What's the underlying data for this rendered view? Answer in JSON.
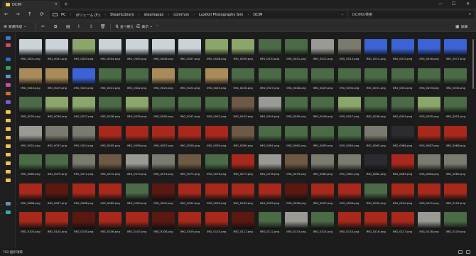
{
  "window": {
    "tab_title": "DCIM",
    "tab_close": "×",
    "tab_add": "+",
    "controls": [
      "—",
      "☐",
      "✕"
    ]
  },
  "nav": {
    "back": "←",
    "forward": "→",
    "up": "↑",
    "refresh": "⟳"
  },
  "breadcrumb": [
    "PC",
    "ボリューム (F:)",
    "SteamLibrary",
    "steamapps",
    "common",
    "Luxifoil Photography Sim",
    "DCIM"
  ],
  "breadcrumb_sep": "›",
  "search": {
    "placeholder": "DCIMの検索"
  },
  "toolbar": {
    "new_label": "新規作成",
    "sort_label": "並べ替え",
    "view_label": "表示",
    "more_label": "···",
    "details_label": "詳細"
  },
  "status": {
    "count_text": "702 個の項目"
  },
  "colors": {
    "accent": "#f2c14e",
    "thumb_palette": {
      "snow": "#c9d3d8",
      "mountain": "#8ba66a",
      "sky": "#3b63d6",
      "beach": "#a98b5a",
      "forest": "#4a6b46",
      "temple": "#7a7a6e",
      "torii": "#a8291c",
      "torii_dark": "#5a1810",
      "shrine": "#6e5a44",
      "night": "#2b2b30",
      "stone": "#9a9a94"
    }
  },
  "files": [
    {
      "name": "IMG_0001.png",
      "tone": "snow"
    },
    {
      "name": "IMG_0002.png",
      "tone": "snow"
    },
    {
      "name": "IMG_0003.png",
      "tone": "mountain"
    },
    {
      "name": "IMG_0004.png",
      "tone": "snow"
    },
    {
      "name": "IMG_0005.png",
      "tone": "snow"
    },
    {
      "name": "IMG_0006.png",
      "tone": "snow"
    },
    {
      "name": "IMG_0007.png",
      "tone": "snow"
    },
    {
      "name": "IMG_0008.png",
      "tone": "mountain"
    },
    {
      "name": "IMG_0009.png",
      "tone": "mountain"
    },
    {
      "name": "IMG_0010.png",
      "tone": "forest"
    },
    {
      "name": "IMG_0011.png",
      "tone": "forest"
    },
    {
      "name": "IMG_0012.png",
      "tone": "stone"
    },
    {
      "name": "IMG_0013.png",
      "tone": "temple"
    },
    {
      "name": "IMG_0014.png",
      "tone": "sky"
    },
    {
      "name": "IMG_0015.png",
      "tone": "sky"
    },
    {
      "name": "IMG_0016.png",
      "tone": "sky"
    },
    {
      "name": "IMG_0017.png",
      "tone": "sky"
    },
    {
      "name": "IMG_0018.png",
      "tone": "beach"
    },
    {
      "name": "IMG_0019.png",
      "tone": "beach"
    },
    {
      "name": "IMG_0020.png",
      "tone": "sky"
    },
    {
      "name": "IMG_0021.png",
      "tone": "forest"
    },
    {
      "name": "IMG_0022.png",
      "tone": "forest"
    },
    {
      "name": "IMG_0023.png",
      "tone": "beach"
    },
    {
      "name": "IMG_0024.png",
      "tone": "forest"
    },
    {
      "name": "IMG_0025.png",
      "tone": "beach"
    },
    {
      "name": "IMG_0026.png",
      "tone": "forest"
    },
    {
      "name": "IMG_0027.png",
      "tone": "forest"
    },
    {
      "name": "IMG_0028.png",
      "tone": "forest"
    },
    {
      "name": "IMG_0029.png",
      "tone": "forest"
    },
    {
      "name": "IMG_0030.png",
      "tone": "forest"
    },
    {
      "name": "IMG_0031.png",
      "tone": "forest"
    },
    {
      "name": "IMG_0032.png",
      "tone": "forest"
    },
    {
      "name": "IMG_0033.png",
      "tone": "forest"
    },
    {
      "name": "IMG_0034.png",
      "tone": "forest"
    },
    {
      "name": "IMG_0035.png",
      "tone": "forest"
    },
    {
      "name": "IMG_0036.png",
      "tone": "mountain"
    },
    {
      "name": "IMG_0037.png",
      "tone": "mountain"
    },
    {
      "name": "IMG_0038.png",
      "tone": "forest"
    },
    {
      "name": "IMG_0039.png",
      "tone": "mountain"
    },
    {
      "name": "IMG_0040.png",
      "tone": "forest"
    },
    {
      "name": "IMG_0041.png",
      "tone": "forest"
    },
    {
      "name": "IMG_0042.png",
      "tone": "forest"
    },
    {
      "name": "IMG_0043.png",
      "tone": "shrine"
    },
    {
      "name": "IMG_0044.png",
      "tone": "stone"
    },
    {
      "name": "IMG_0045.png",
      "tone": "forest"
    },
    {
      "name": "IMG_0046.png",
      "tone": "forest"
    },
    {
      "name": "IMG_0047.png",
      "tone": "mountain"
    },
    {
      "name": "IMG_0048.png",
      "tone": "forest"
    },
    {
      "name": "IMG_0049.png",
      "tone": "forest"
    },
    {
      "name": "IMG_0050.png",
      "tone": "mountain"
    },
    {
      "name": "IMG_0051.png",
      "tone": "forest"
    },
    {
      "name": "IMG_0052.png",
      "tone": "stone"
    },
    {
      "name": "IMG_0053.png",
      "tone": "temple"
    },
    {
      "name": "IMG_0054.png",
      "tone": "temple"
    },
    {
      "name": "IMG_0055.png",
      "tone": "torii"
    },
    {
      "name": "IMG_0056.png",
      "tone": "torii"
    },
    {
      "name": "IMG_0057.png",
      "tone": "torii"
    },
    {
      "name": "IMG_0058.png",
      "tone": "torii"
    },
    {
      "name": "IMG_0059.png",
      "tone": "torii"
    },
    {
      "name": "IMG_0060.png",
      "tone": "shrine"
    },
    {
      "name": "IMG_0061.png",
      "tone": "forest"
    },
    {
      "name": "IMG_0062.png",
      "tone": "forest"
    },
    {
      "name": "IMG_0063.png",
      "tone": "forest"
    },
    {
      "name": "IMG_0064.png",
      "tone": "forest"
    },
    {
      "name": "IMG_0065.png",
      "tone": "temple"
    },
    {
      "name": "IMG_0066.png",
      "tone": "night"
    },
    {
      "name": "IMG_0067.png",
      "tone": "torii"
    },
    {
      "name": "IMG_0068.png",
      "tone": "torii"
    },
    {
      "name": "IMG_0069.png",
      "tone": "forest"
    },
    {
      "name": "IMG_0070.png",
      "tone": "forest"
    },
    {
      "name": "IMG_0071.png",
      "tone": "temple"
    },
    {
      "name": "IMG_0072.png",
      "tone": "shrine"
    },
    {
      "name": "IMG_0073.png",
      "tone": "stone"
    },
    {
      "name": "IMG_0074.png",
      "tone": "temple"
    },
    {
      "name": "IMG_0075.png",
      "tone": "shrine"
    },
    {
      "name": "IMG_0076.png",
      "tone": "forest"
    },
    {
      "name": "IMG_0077.png",
      "tone": "torii"
    },
    {
      "name": "IMG_0078.png",
      "tone": "stone"
    },
    {
      "name": "IMG_0079.png",
      "tone": "shrine"
    },
    {
      "name": "IMG_0080.png",
      "tone": "temple"
    },
    {
      "name": "IMG_0081.png",
      "tone": "temple"
    },
    {
      "name": "IMG_0082.png",
      "tone": "night"
    },
    {
      "name": "IMG_0083.png",
      "tone": "torii"
    },
    {
      "name": "IMG_0084.png",
      "tone": "temple"
    },
    {
      "name": "IMG_0085.png",
      "tone": "temple"
    },
    {
      "name": "IMG_0086.png",
      "tone": "torii"
    },
    {
      "name": "IMG_0087.png",
      "tone": "torii_dark"
    },
    {
      "name": "IMG_0088.png",
      "tone": "torii"
    },
    {
      "name": "IMG_0089.png",
      "tone": "torii"
    },
    {
      "name": "IMG_0090.png",
      "tone": "forest"
    },
    {
      "name": "IMG_0091.png",
      "tone": "torii_dark"
    },
    {
      "name": "IMG_0092.png",
      "tone": "torii"
    },
    {
      "name": "IMG_0093.png",
      "tone": "torii"
    },
    {
      "name": "IMG_0094.png",
      "tone": "torii"
    },
    {
      "name": "IMG_0095.png",
      "tone": "torii"
    },
    {
      "name": "IMG_0096.png",
      "tone": "torii_dark"
    },
    {
      "name": "IMG_0097.png",
      "tone": "torii"
    },
    {
      "name": "IMG_0098.png",
      "tone": "torii"
    },
    {
      "name": "IMG_0099.png",
      "tone": "forest"
    },
    {
      "name": "IMG_0100.png",
      "tone": "torii"
    },
    {
      "name": "IMG_0101.png",
      "tone": "torii"
    },
    {
      "name": "IMG_0102.png",
      "tone": "torii"
    },
    {
      "name": "IMG_0103.png",
      "tone": "torii"
    },
    {
      "name": "IMG_0104.png",
      "tone": "torii"
    },
    {
      "name": "IMG_0105.png",
      "tone": "torii_dark"
    },
    {
      "name": "IMG_0106.png",
      "tone": "torii"
    },
    {
      "name": "IMG_0107.png",
      "tone": "torii"
    },
    {
      "name": "IMG_0108.png",
      "tone": "torii_dark"
    },
    {
      "name": "IMG_0109.png",
      "tone": "torii"
    },
    {
      "name": "IMG_0110.png",
      "tone": "torii"
    },
    {
      "name": "IMG_0111.png",
      "tone": "torii_dark"
    },
    {
      "name": "IMG_0112.png",
      "tone": "forest"
    },
    {
      "name": "IMG_0113.png",
      "tone": "stone"
    },
    {
      "name": "IMG_0114.png",
      "tone": "forest"
    },
    {
      "name": "IMG_0115.png",
      "tone": "torii"
    },
    {
      "name": "IMG_0116.png",
      "tone": "torii"
    },
    {
      "name": "IMG_0117.png",
      "tone": "torii"
    },
    {
      "name": "IMG_0118.png",
      "tone": "stone"
    },
    {
      "name": "IMG_0119.png",
      "tone": "forest"
    }
  ]
}
